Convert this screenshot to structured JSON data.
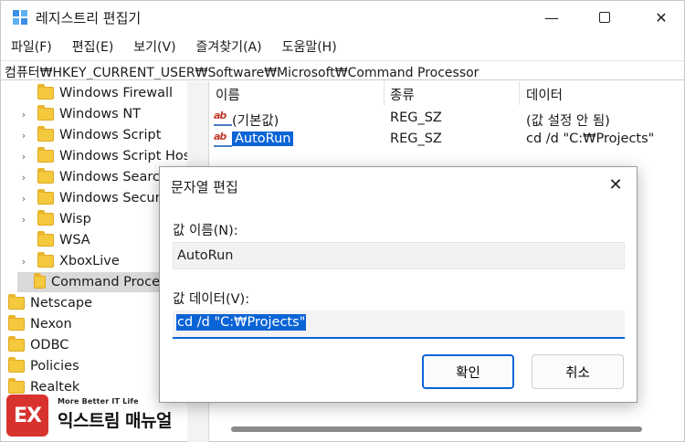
{
  "window": {
    "title": "레지스트리 편집기",
    "min_glyph": "—",
    "close_glyph": "✕"
  },
  "menu": [
    "파일(F)",
    "편집(E)",
    "보기(V)",
    "즐겨찾기(A)",
    "도움말(H)"
  ],
  "address": "컴퓨터₩HKEY_CURRENT_USER₩Software₩Microsoft₩Command Processor",
  "tree": {
    "items": [
      {
        "label": "Windows Firewall",
        "chevron": ""
      },
      {
        "label": "Windows NT",
        "chevron": "›"
      },
      {
        "label": "Windows Script",
        "chevron": "›"
      },
      {
        "label": "Windows Script Host",
        "chevron": "›"
      },
      {
        "label": "Windows Search",
        "chevron": "›"
      },
      {
        "label": "Windows Security",
        "chevron": "›"
      },
      {
        "label": "Wisp",
        "chevron": "›"
      },
      {
        "label": "WSA",
        "chevron": ""
      },
      {
        "label": "XboxLive",
        "chevron": "›"
      },
      {
        "label": "Command Processor",
        "chevron": ""
      },
      {
        "label": "Netscape",
        "chevron": ""
      },
      {
        "label": "Nexon",
        "chevron": ""
      },
      {
        "label": "ODBC",
        "chevron": ""
      },
      {
        "label": "Policies",
        "chevron": ""
      },
      {
        "label": "Realtek",
        "chevron": ""
      }
    ]
  },
  "list": {
    "headers": {
      "name": "이름",
      "type": "종류",
      "data": "데이터"
    },
    "rows": [
      {
        "name": "(기본값)",
        "type": "REG_SZ",
        "data": "(값 설정 안 됨)"
      },
      {
        "name": "AutoRun",
        "type": "REG_SZ",
        "data": "cd /d \"C:₩Projects\""
      }
    ]
  },
  "dialog": {
    "title": "문자열 편집",
    "close_glyph": "✕",
    "name_label": "값 이름(N):",
    "name_value": "AutoRun",
    "data_label": "값 데이터(V):",
    "data_value": "cd /d \"C:₩Projects\"",
    "ok_label": "확인",
    "cancel_label": "취소"
  },
  "watermark": {
    "badge": "EX",
    "tagline": "More Better IT Life",
    "brand": "익스트림 매뉴얼"
  },
  "colors": {
    "accent": "#0a64d6",
    "folder": "#f5c93e",
    "badge": "#d8322f"
  }
}
